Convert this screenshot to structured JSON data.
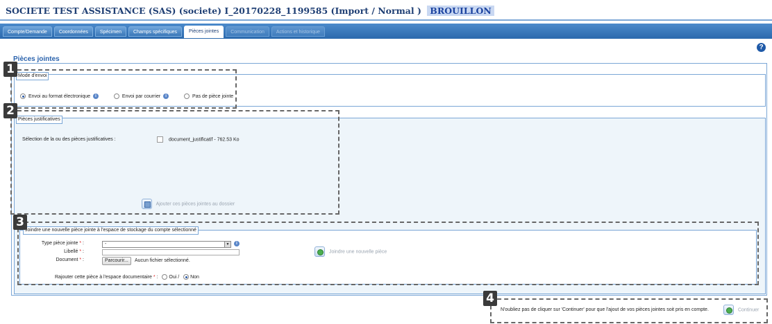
{
  "header": {
    "title": "SOCIETE TEST ASSISTANCE (SAS) (societe)  I_20170228_1199585 (Import / Normal )",
    "status_badge": "BROUILLON"
  },
  "tabs": [
    {
      "label": "Compte/Demande",
      "state": "normal"
    },
    {
      "label": "Coordonnées",
      "state": "normal"
    },
    {
      "label": "Spécimen",
      "state": "normal"
    },
    {
      "label": "Champs spécifiques",
      "state": "normal"
    },
    {
      "label": "Pièces jointes",
      "state": "active"
    },
    {
      "label": "Communication",
      "state": "disabled"
    },
    {
      "label": "Actions et historique",
      "state": "disabled"
    }
  ],
  "help_icon": "?",
  "section_title": "Pièces jointes",
  "mode_envoi": {
    "legend": "Mode d'envoi",
    "options": [
      {
        "label": "Envoi au format électronique",
        "selected": true,
        "info": true
      },
      {
        "label": "Envoi par courrier",
        "selected": false,
        "info": true
      },
      {
        "label": "Pas de pièce jointe",
        "selected": false,
        "info": false
      }
    ]
  },
  "pieces": {
    "legend": "Pièces justificatives",
    "selection_label": "Sélection de la ou des pièces justificatives :",
    "document": "document_justificatif - 762.53 Ko",
    "add_action": "Ajouter ces pièces jointes au dossier"
  },
  "nouvelle": {
    "legend": "Joindre une nouvelle pièce jointe à l'espace de stockage du compte sélectionné",
    "type_label": "Type pièce jointe",
    "type_value": "-",
    "libelle_label": "Libellé",
    "document_label": "Document",
    "browse_label": "Parcourir...",
    "no_file": "Aucun fichier sélectionné.",
    "add_action": "Joindre une nouvelle pièce",
    "rajouter_label": "Rajouter cette pièce à l'espace documentaire",
    "oui": "Oui",
    "separator": "/",
    "non": "Non",
    "required_mark": "*",
    "colon": ":"
  },
  "footer": {
    "note": "N'oubliez pas de cliquer sur 'Continuer' pour que l'ajout de vos pièces jointes soit pris en compte.",
    "continue_label": "Continuer"
  },
  "callouts": [
    "1",
    "2",
    "3",
    "4"
  ],
  "icons": {
    "info": "info-icon",
    "help": "help-icon",
    "green_action": "green-check-icon",
    "disk_action": "disk-icon"
  },
  "colors": {
    "title": "#1f3f74",
    "tab_bar": "#2b69ad",
    "panel_border": "#7aa6d6",
    "status_badge_bg": "#c9d8f2"
  }
}
